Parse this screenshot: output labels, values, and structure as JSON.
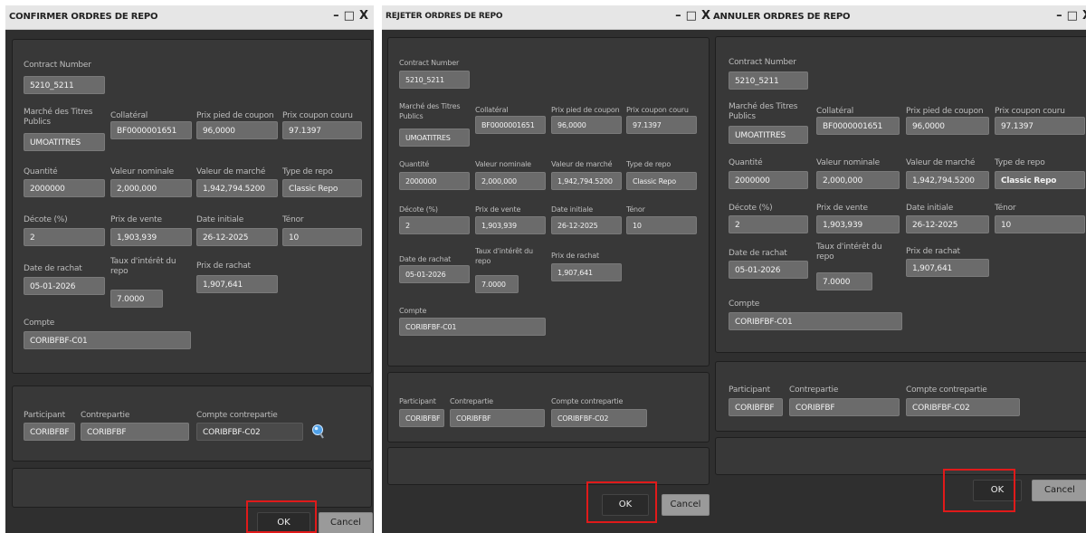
{
  "colors": {
    "highlight": "#e01a1a",
    "window_bg": "#2f2f2f",
    "field_bg": "#6b6b6b",
    "title_bg": "#e6e6e6"
  },
  "window_controls": {
    "minimize": "–",
    "maximize": "□",
    "close": "X"
  },
  "labels": {
    "contract_number": "Contract Number",
    "marche": "Marché des Titres Publics",
    "collateral": "Collatéral",
    "prix_pied": "Prix pied de coupon",
    "prix_couru": "Prix coupon couru",
    "quantite": "Quantité",
    "valeur_nominale": "Valeur nominale",
    "valeur_marche": "Valeur de marché",
    "type_repo": "Type de repo",
    "decote": "Décote (%)",
    "prix_vente": "Prix de vente",
    "date_initiale": "Date initiale",
    "tenor": "Ténor",
    "date_rachat": "Date de rachat",
    "taux_interet": "Taux d'intérêt du repo",
    "prix_rachat": "Prix de rachat",
    "compte": "Compte",
    "participant": "Participant",
    "contrepartie": "Contrepartie",
    "compte_contrepartie": "Compte contrepartie"
  },
  "values": {
    "contract_number": "5210_5211",
    "marche": "UMOATITRES",
    "collateral": "BF0000001651",
    "prix_pied": "96,0000",
    "prix_couru": "97.1397",
    "quantite": "2000000",
    "valeur_nominale": "2,000,000",
    "valeur_marche": "1,942,794.5200",
    "type_repo": "Classic Repo",
    "decote": "2",
    "prix_vente": "1,903,939",
    "date_initiale": "26-12-2025",
    "tenor": "10",
    "date_rachat": "05-01-2026",
    "taux_interet": "7.0000",
    "prix_rachat": "1,907,641",
    "compte": "CORIBFBF-C01",
    "participant": "CORIBFBF",
    "contrepartie": "CORIBFBF",
    "compte_contrepartie": "CORIBFBF-C02"
  },
  "windows": [
    {
      "title": "CONFIRMER ORDRES DE REPO",
      "ok_label": "OK",
      "cancel_label": "Cancel"
    },
    {
      "title": "REJETER ORDRES DE REPO",
      "ok_label": "OK",
      "cancel_label": "Cancel"
    },
    {
      "title": "ANNULER ORDRES DE REPO",
      "ok_label": "OK",
      "cancel_label": "Cancel"
    }
  ]
}
